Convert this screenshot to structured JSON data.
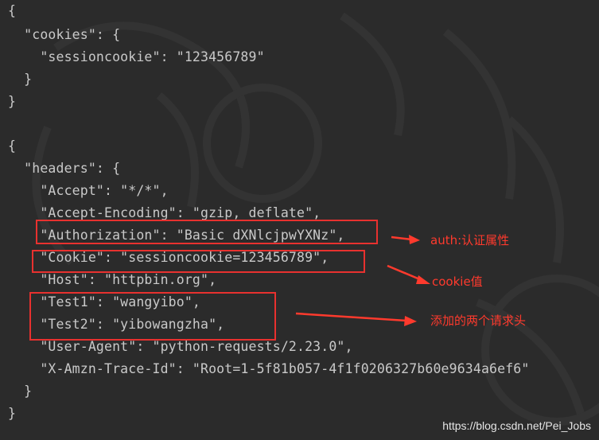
{
  "lines": [
    "{",
    "  \"cookies\": {",
    "    \"sessioncookie\": \"123456789\"",
    "  }",
    "}",
    "",
    "{",
    "  \"headers\": {",
    "    \"Accept\": \"*/*\",",
    "    \"Accept-Encoding\": \"gzip, deflate\",",
    "    \"Authorization\": \"Basic dXNlcjpwYXNz\",",
    "    \"Cookie\": \"sessioncookie=123456789\",",
    "    \"Host\": \"httpbin.org\",",
    "    \"Test1\": \"wangyibo\",",
    "    \"Test2\": \"yibowangzha\",",
    "    \"User-Agent\": \"python-requests/2.23.0\",",
    "    \"X-Amzn-Trace-Id\": \"Root=1-5f81b057-4f1f0206327b60e9634a6ef6\"",
    "  }",
    "}"
  ],
  "annotations": {
    "auth": "auth:认证属性",
    "cookie": "cookie值",
    "added_headers": "添加的两个请求头"
  },
  "watermark": "https://blog.csdn.net/Pei_Jobs",
  "colors": {
    "background": "#2b2b2b",
    "text": "#c9c9c9",
    "annotation": "#ff3a2d"
  }
}
